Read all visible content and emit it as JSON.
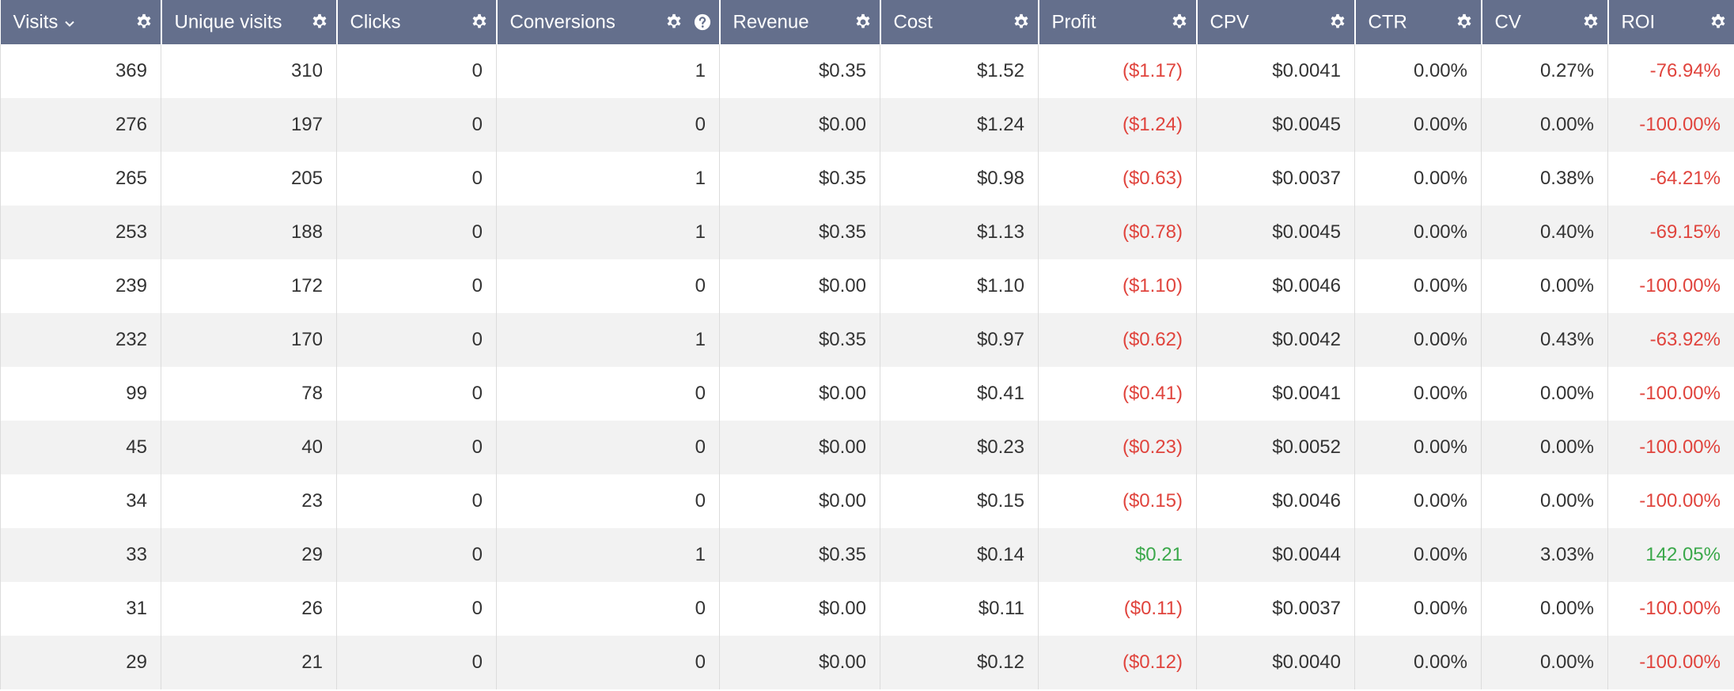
{
  "colors": {
    "header_bg": "#646f8c",
    "negative": "#e0443d",
    "positive": "#3aa84a",
    "stripe": "#f2f2f2"
  },
  "columns": [
    {
      "key": "visits",
      "label": "Visits",
      "sort_icon": "chevron-down-icon",
      "icons": [
        "gear-icon"
      ]
    },
    {
      "key": "unique_visits",
      "label": "Unique visits",
      "icons": [
        "gear-icon"
      ]
    },
    {
      "key": "clicks",
      "label": "Clicks",
      "icons": [
        "gear-icon"
      ]
    },
    {
      "key": "conversions",
      "label": "Conversions",
      "icons": [
        "gear-icon",
        "help-icon"
      ]
    },
    {
      "key": "revenue",
      "label": "Revenue",
      "icons": [
        "gear-icon"
      ]
    },
    {
      "key": "cost",
      "label": "Cost",
      "icons": [
        "gear-icon"
      ]
    },
    {
      "key": "profit",
      "label": "Profit",
      "icons": [
        "gear-icon"
      ]
    },
    {
      "key": "cpv",
      "label": "CPV",
      "icons": [
        "gear-icon"
      ]
    },
    {
      "key": "ctr",
      "label": "CTR",
      "icons": [
        "gear-icon"
      ]
    },
    {
      "key": "cv",
      "label": "CV",
      "icons": [
        "gear-icon"
      ]
    },
    {
      "key": "roi",
      "label": "ROI",
      "icons": [
        "gear-icon"
      ]
    }
  ],
  "rows": [
    {
      "visits": "369",
      "unique_visits": "310",
      "clicks": "0",
      "conversions": "1",
      "revenue": "$0.35",
      "cost": "$1.52",
      "profit": "($1.17)",
      "cpv": "$0.0041",
      "ctr": "0.00%",
      "cv": "0.27%",
      "roi": "-76.94%",
      "trend": "negative"
    },
    {
      "visits": "276",
      "unique_visits": "197",
      "clicks": "0",
      "conversions": "0",
      "revenue": "$0.00",
      "cost": "$1.24",
      "profit": "($1.24)",
      "cpv": "$0.0045",
      "ctr": "0.00%",
      "cv": "0.00%",
      "roi": "-100.00%",
      "trend": "negative"
    },
    {
      "visits": "265",
      "unique_visits": "205",
      "clicks": "0",
      "conversions": "1",
      "revenue": "$0.35",
      "cost": "$0.98",
      "profit": "($0.63)",
      "cpv": "$0.0037",
      "ctr": "0.00%",
      "cv": "0.38%",
      "roi": "-64.21%",
      "trend": "negative"
    },
    {
      "visits": "253",
      "unique_visits": "188",
      "clicks": "0",
      "conversions": "1",
      "revenue": "$0.35",
      "cost": "$1.13",
      "profit": "($0.78)",
      "cpv": "$0.0045",
      "ctr": "0.00%",
      "cv": "0.40%",
      "roi": "-69.15%",
      "trend": "negative"
    },
    {
      "visits": "239",
      "unique_visits": "172",
      "clicks": "0",
      "conversions": "0",
      "revenue": "$0.00",
      "cost": "$1.10",
      "profit": "($1.10)",
      "cpv": "$0.0046",
      "ctr": "0.00%",
      "cv": "0.00%",
      "roi": "-100.00%",
      "trend": "negative"
    },
    {
      "visits": "232",
      "unique_visits": "170",
      "clicks": "0",
      "conversions": "1",
      "revenue": "$0.35",
      "cost": "$0.97",
      "profit": "($0.62)",
      "cpv": "$0.0042",
      "ctr": "0.00%",
      "cv": "0.43%",
      "roi": "-63.92%",
      "trend": "negative"
    },
    {
      "visits": "99",
      "unique_visits": "78",
      "clicks": "0",
      "conversions": "0",
      "revenue": "$0.00",
      "cost": "$0.41",
      "profit": "($0.41)",
      "cpv": "$0.0041",
      "ctr": "0.00%",
      "cv": "0.00%",
      "roi": "-100.00%",
      "trend": "negative"
    },
    {
      "visits": "45",
      "unique_visits": "40",
      "clicks": "0",
      "conversions": "0",
      "revenue": "$0.00",
      "cost": "$0.23",
      "profit": "($0.23)",
      "cpv": "$0.0052",
      "ctr": "0.00%",
      "cv": "0.00%",
      "roi": "-100.00%",
      "trend": "negative"
    },
    {
      "visits": "34",
      "unique_visits": "23",
      "clicks": "0",
      "conversions": "0",
      "revenue": "$0.00",
      "cost": "$0.15",
      "profit": "($0.15)",
      "cpv": "$0.0046",
      "ctr": "0.00%",
      "cv": "0.00%",
      "roi": "-100.00%",
      "trend": "negative"
    },
    {
      "visits": "33",
      "unique_visits": "29",
      "clicks": "0",
      "conversions": "1",
      "revenue": "$0.35",
      "cost": "$0.14",
      "profit": "$0.21",
      "cpv": "$0.0044",
      "ctr": "0.00%",
      "cv": "3.03%",
      "roi": "142.05%",
      "trend": "positive"
    },
    {
      "visits": "31",
      "unique_visits": "26",
      "clicks": "0",
      "conversions": "0",
      "revenue": "$0.00",
      "cost": "$0.11",
      "profit": "($0.11)",
      "cpv": "$0.0037",
      "ctr": "0.00%",
      "cv": "0.00%",
      "roi": "-100.00%",
      "trend": "negative"
    },
    {
      "visits": "29",
      "unique_visits": "21",
      "clicks": "0",
      "conversions": "0",
      "revenue": "$0.00",
      "cost": "$0.12",
      "profit": "($0.12)",
      "cpv": "$0.0040",
      "ctr": "0.00%",
      "cv": "0.00%",
      "roi": "-100.00%",
      "trend": "negative"
    }
  ]
}
